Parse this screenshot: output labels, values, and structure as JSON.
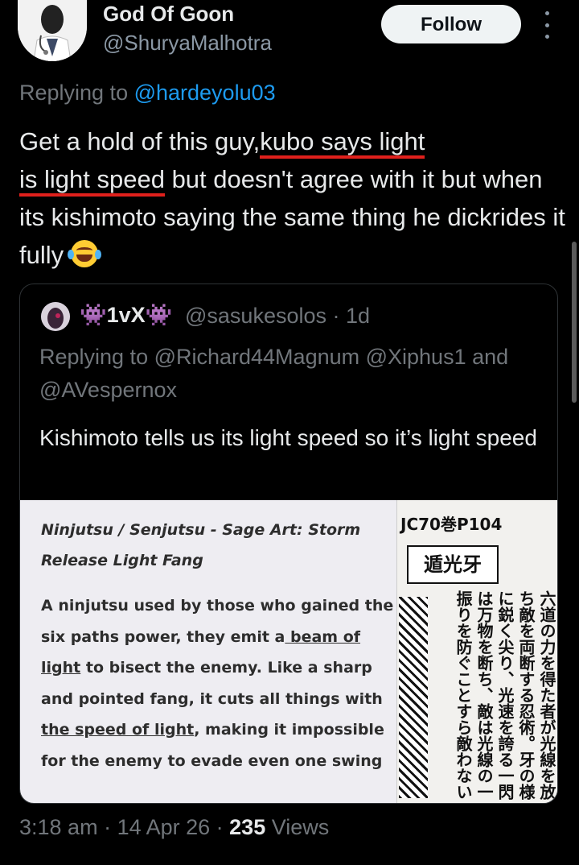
{
  "author": {
    "name": "God Of Goon",
    "handle": "@ShuryaMalhotra",
    "avatar_icon": "doctor-avatar-icon",
    "follow_label": "Follow"
  },
  "reply": {
    "prefix": "Replying to ",
    "mention": "@hardeyolu03"
  },
  "tweet": {
    "part1": "Get a hold of this guy,",
    "underlined1": "kubo says light",
    "underlined2": "is light speed",
    "part2": " but doesn't agree with it but when its kishimoto saying the same thing he dickrides it fully ",
    "emoji": "face-with-tears-of-joy-emoji",
    "underline_color": "#e0201c"
  },
  "quote": {
    "name_prefix": "👾1vX👾",
    "handle_time": "@sasukesolos · 1d",
    "replying": "Replying to @Richard44Magnum @Xiphus1 and @AVespernox",
    "text": "Kishimoto tells us its light speed so it’s light speed",
    "image": {
      "title": "Ninjutsu / Senjutsu - Sage Art: Storm Release Light Fang",
      "body_a": "A ninjutsu used by those who gained the six paths power, they emit a",
      "body_ul1": " beam of light",
      "body_b": " to bisect the enemy. Like a sharp and pointed fang, it cuts all things with ",
      "body_ul2": "the speed of light",
      "body_c": ", making it impossible for the enemy to evade even one swing",
      "manga_header": "JC70巻P104",
      "manga_title": "遁光牙",
      "manga_cols": [
        "六道の力を得た者が光線を放",
        "ち敵を両断する忍術。牙の様",
        "に鋭く尖り、光速を誇る一閃",
        "は万物を断ち、敵は光線の一",
        "振りを防ぐことすら敵わない"
      ]
    }
  },
  "footer": {
    "time": "3:18 am",
    "date": "14 Apr 26",
    "views_count": "235",
    "views_label": " Views",
    "sep": " · "
  },
  "colors": {
    "background": "#000000",
    "text": "#e7e9ea",
    "muted": "#71767b",
    "link": "#1d9bf0"
  }
}
